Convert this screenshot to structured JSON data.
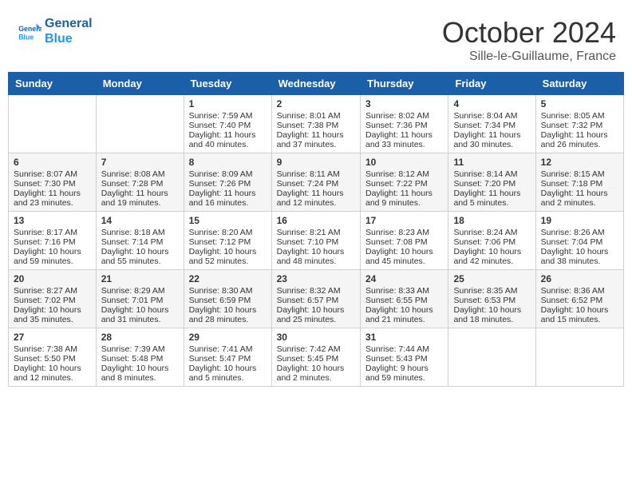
{
  "header": {
    "logo_line1": "General",
    "logo_line2": "Blue",
    "month_title": "October 2024",
    "location": "Sille-le-Guillaume, France"
  },
  "days_of_week": [
    "Sunday",
    "Monday",
    "Tuesday",
    "Wednesday",
    "Thursday",
    "Friday",
    "Saturday"
  ],
  "weeks": [
    [
      {
        "day": "",
        "sunrise": "",
        "sunset": "",
        "daylight": ""
      },
      {
        "day": "",
        "sunrise": "",
        "sunset": "",
        "daylight": ""
      },
      {
        "day": "1",
        "sunrise": "Sunrise: 7:59 AM",
        "sunset": "Sunset: 7:40 PM",
        "daylight": "Daylight: 11 hours and 40 minutes."
      },
      {
        "day": "2",
        "sunrise": "Sunrise: 8:01 AM",
        "sunset": "Sunset: 7:38 PM",
        "daylight": "Daylight: 11 hours and 37 minutes."
      },
      {
        "day": "3",
        "sunrise": "Sunrise: 8:02 AM",
        "sunset": "Sunset: 7:36 PM",
        "daylight": "Daylight: 11 hours and 33 minutes."
      },
      {
        "day": "4",
        "sunrise": "Sunrise: 8:04 AM",
        "sunset": "Sunset: 7:34 PM",
        "daylight": "Daylight: 11 hours and 30 minutes."
      },
      {
        "day": "5",
        "sunrise": "Sunrise: 8:05 AM",
        "sunset": "Sunset: 7:32 PM",
        "daylight": "Daylight: 11 hours and 26 minutes."
      }
    ],
    [
      {
        "day": "6",
        "sunrise": "Sunrise: 8:07 AM",
        "sunset": "Sunset: 7:30 PM",
        "daylight": "Daylight: 11 hours and 23 minutes."
      },
      {
        "day": "7",
        "sunrise": "Sunrise: 8:08 AM",
        "sunset": "Sunset: 7:28 PM",
        "daylight": "Daylight: 11 hours and 19 minutes."
      },
      {
        "day": "8",
        "sunrise": "Sunrise: 8:09 AM",
        "sunset": "Sunset: 7:26 PM",
        "daylight": "Daylight: 11 hours and 16 minutes."
      },
      {
        "day": "9",
        "sunrise": "Sunrise: 8:11 AM",
        "sunset": "Sunset: 7:24 PM",
        "daylight": "Daylight: 11 hours and 12 minutes."
      },
      {
        "day": "10",
        "sunrise": "Sunrise: 8:12 AM",
        "sunset": "Sunset: 7:22 PM",
        "daylight": "Daylight: 11 hours and 9 minutes."
      },
      {
        "day": "11",
        "sunrise": "Sunrise: 8:14 AM",
        "sunset": "Sunset: 7:20 PM",
        "daylight": "Daylight: 11 hours and 5 minutes."
      },
      {
        "day": "12",
        "sunrise": "Sunrise: 8:15 AM",
        "sunset": "Sunset: 7:18 PM",
        "daylight": "Daylight: 11 hours and 2 minutes."
      }
    ],
    [
      {
        "day": "13",
        "sunrise": "Sunrise: 8:17 AM",
        "sunset": "Sunset: 7:16 PM",
        "daylight": "Daylight: 10 hours and 59 minutes."
      },
      {
        "day": "14",
        "sunrise": "Sunrise: 8:18 AM",
        "sunset": "Sunset: 7:14 PM",
        "daylight": "Daylight: 10 hours and 55 minutes."
      },
      {
        "day": "15",
        "sunrise": "Sunrise: 8:20 AM",
        "sunset": "Sunset: 7:12 PM",
        "daylight": "Daylight: 10 hours and 52 minutes."
      },
      {
        "day": "16",
        "sunrise": "Sunrise: 8:21 AM",
        "sunset": "Sunset: 7:10 PM",
        "daylight": "Daylight: 10 hours and 48 minutes."
      },
      {
        "day": "17",
        "sunrise": "Sunrise: 8:23 AM",
        "sunset": "Sunset: 7:08 PM",
        "daylight": "Daylight: 10 hours and 45 minutes."
      },
      {
        "day": "18",
        "sunrise": "Sunrise: 8:24 AM",
        "sunset": "Sunset: 7:06 PM",
        "daylight": "Daylight: 10 hours and 42 minutes."
      },
      {
        "day": "19",
        "sunrise": "Sunrise: 8:26 AM",
        "sunset": "Sunset: 7:04 PM",
        "daylight": "Daylight: 10 hours and 38 minutes."
      }
    ],
    [
      {
        "day": "20",
        "sunrise": "Sunrise: 8:27 AM",
        "sunset": "Sunset: 7:02 PM",
        "daylight": "Daylight: 10 hours and 35 minutes."
      },
      {
        "day": "21",
        "sunrise": "Sunrise: 8:29 AM",
        "sunset": "Sunset: 7:01 PM",
        "daylight": "Daylight: 10 hours and 31 minutes."
      },
      {
        "day": "22",
        "sunrise": "Sunrise: 8:30 AM",
        "sunset": "Sunset: 6:59 PM",
        "daylight": "Daylight: 10 hours and 28 minutes."
      },
      {
        "day": "23",
        "sunrise": "Sunrise: 8:32 AM",
        "sunset": "Sunset: 6:57 PM",
        "daylight": "Daylight: 10 hours and 25 minutes."
      },
      {
        "day": "24",
        "sunrise": "Sunrise: 8:33 AM",
        "sunset": "Sunset: 6:55 PM",
        "daylight": "Daylight: 10 hours and 21 minutes."
      },
      {
        "day": "25",
        "sunrise": "Sunrise: 8:35 AM",
        "sunset": "Sunset: 6:53 PM",
        "daylight": "Daylight: 10 hours and 18 minutes."
      },
      {
        "day": "26",
        "sunrise": "Sunrise: 8:36 AM",
        "sunset": "Sunset: 6:52 PM",
        "daylight": "Daylight: 10 hours and 15 minutes."
      }
    ],
    [
      {
        "day": "27",
        "sunrise": "Sunrise: 7:38 AM",
        "sunset": "Sunset: 5:50 PM",
        "daylight": "Daylight: 10 hours and 12 minutes."
      },
      {
        "day": "28",
        "sunrise": "Sunrise: 7:39 AM",
        "sunset": "Sunset: 5:48 PM",
        "daylight": "Daylight: 10 hours and 8 minutes."
      },
      {
        "day": "29",
        "sunrise": "Sunrise: 7:41 AM",
        "sunset": "Sunset: 5:47 PM",
        "daylight": "Daylight: 10 hours and 5 minutes."
      },
      {
        "day": "30",
        "sunrise": "Sunrise: 7:42 AM",
        "sunset": "Sunset: 5:45 PM",
        "daylight": "Daylight: 10 hours and 2 minutes."
      },
      {
        "day": "31",
        "sunrise": "Sunrise: 7:44 AM",
        "sunset": "Sunset: 5:43 PM",
        "daylight": "Daylight: 9 hours and 59 minutes."
      },
      {
        "day": "",
        "sunrise": "",
        "sunset": "",
        "daylight": ""
      },
      {
        "day": "",
        "sunrise": "",
        "sunset": "",
        "daylight": ""
      }
    ]
  ]
}
